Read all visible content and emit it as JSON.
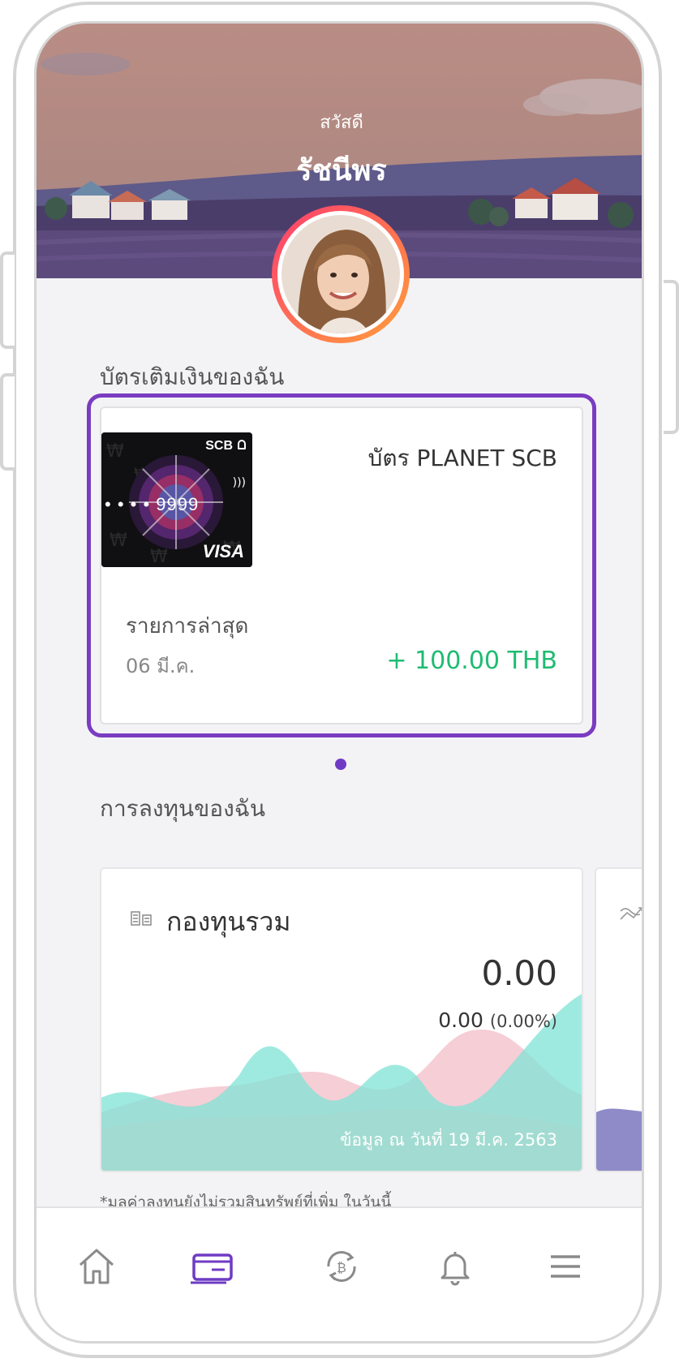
{
  "header": {
    "greeting": "สวัสดี",
    "user_name": "รัชนีพร"
  },
  "prepaid_section": {
    "title": "บัตรเติมเงินของฉัน",
    "card": {
      "brand": "SCB",
      "network": "VISA",
      "masked_number": "• • • •  9999",
      "name": "บัตร PLANET SCB",
      "recent_label": "รายการล่าสุด",
      "recent_date": "06 มี.ค.",
      "recent_amount": "+ 100.00 THB"
    },
    "pager_count": 1
  },
  "invest_section": {
    "title": "การลงทุนของฉัน",
    "fund": {
      "title": "กองทุนรวม",
      "value": "0.00",
      "change": "0.00",
      "change_pct": "(0.00%)",
      "as_of": "ข้อมูล ณ วันที่  19 มี.ค. 2563"
    },
    "footnote": "*มูลค่าลงทุนยังไม่รวมสินทรัพย์ที่เพิ่ม ในวันนี้"
  },
  "tabs": [
    "home-icon",
    "card-icon",
    "crypto-exchange-icon",
    "bell-icon",
    "menu-icon"
  ],
  "colors": {
    "accent": "#7a3cc0",
    "positive": "#1ebc72",
    "chart_teal": "#7fe3d6",
    "chart_pink": "#f4c6cf"
  }
}
